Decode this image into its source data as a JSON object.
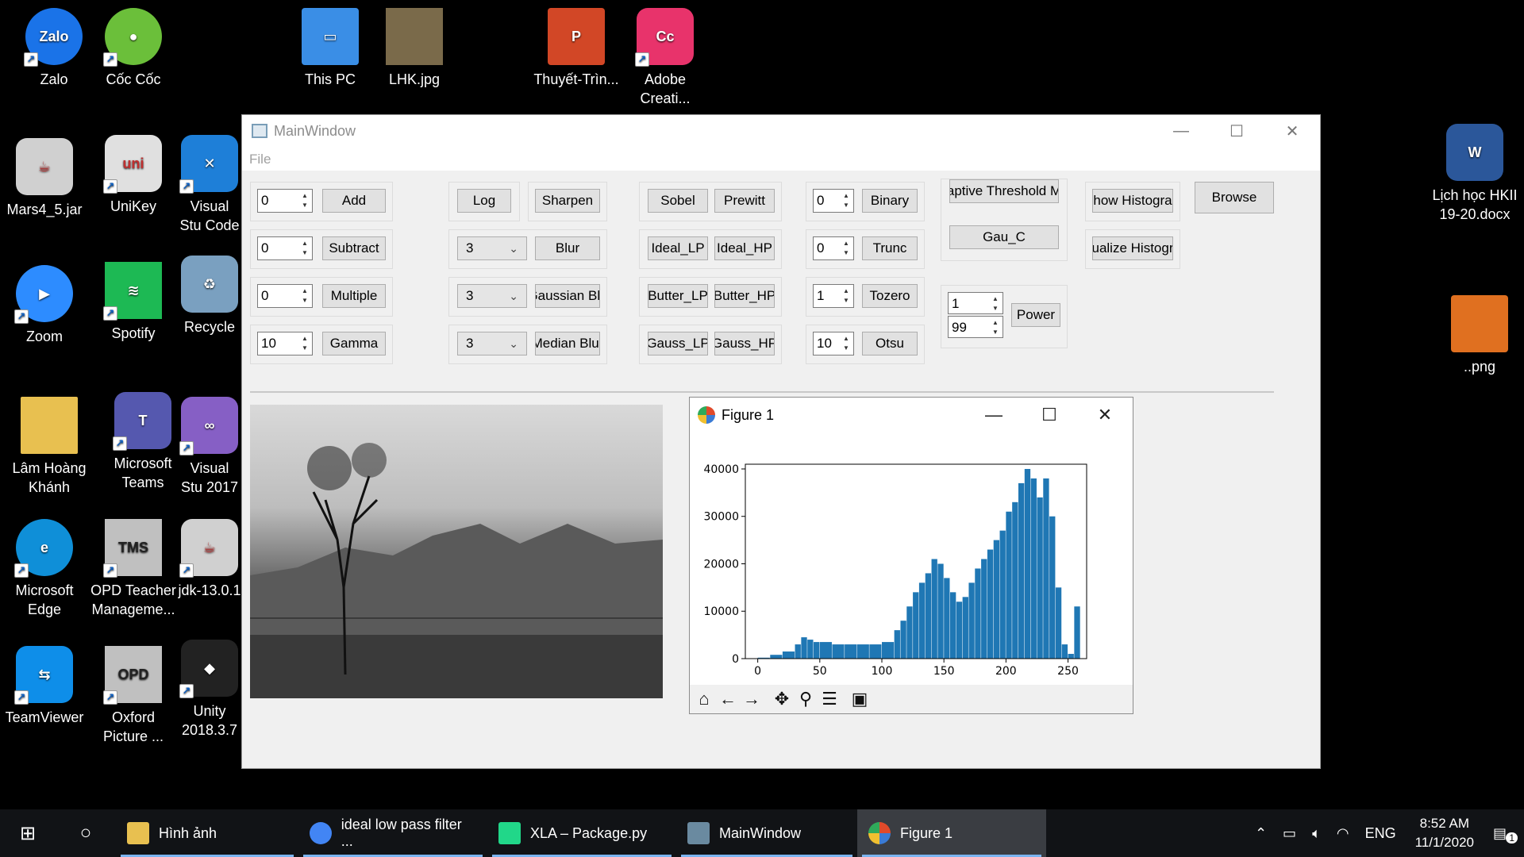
{
  "desktop": {
    "icons": [
      {
        "label": "Zalo",
        "color": "#1a73e8"
      },
      {
        "label": "Cốc Cốc",
        "color": "#6bbf3a"
      },
      {
        "label": "This PC",
        "color": "#3a8ee6"
      },
      {
        "label": "LHK.jpg",
        "color": "#7a6a4a"
      },
      {
        "label": "Thuyết-Trìn...",
        "color": "#d24726"
      },
      {
        "label": "Adobe Creati...",
        "color": "#e8336b"
      },
      {
        "label": "Mars4_5.jar",
        "color": "#d0d0d0"
      },
      {
        "label": "UniKey",
        "color": "#e0e0e0"
      },
      {
        "label": "Visual Stu Code",
        "color": "#1e7fd8"
      },
      {
        "label": "Lịch học HKII 19-20.docx",
        "color": "#2b579a"
      },
      {
        "label": "Zoom",
        "color": "#2d8cff"
      },
      {
        "label": "Spotify",
        "color": "#1db954"
      },
      {
        "label": "Recycle",
        "color": "#7aa0c0"
      },
      {
        "label": "..png",
        "color": "#e07020"
      },
      {
        "label": "Lâm Hoàng Khánh",
        "color": "#e8c050"
      },
      {
        "label": "Microsoft Teams",
        "color": "#5558af"
      },
      {
        "label": "Visual Stu 2017",
        "color": "#865fc5"
      },
      {
        "label": "Microsoft Edge",
        "color": "#0f8fd8"
      },
      {
        "label": "OPD Teacher Manageme...",
        "color": "#c0c0c0"
      },
      {
        "label": "jdk-13.0.1",
        "color": "#d0d0d0"
      },
      {
        "label": "TeamViewer",
        "color": "#0e8ee9"
      },
      {
        "label": "Oxford Picture ...",
        "color": "#c0c0c0"
      },
      {
        "label": "Unity 2018.3.7",
        "color": "#222222"
      }
    ]
  },
  "main_window": {
    "title": "MainWindow",
    "menu_file": "File",
    "controls": {
      "add_value": "0",
      "add_label": "Add",
      "subtract_value": "0",
      "subtract_label": "Subtract",
      "multiple_value": "0",
      "multiple_label": "Multiple",
      "gamma_value": "10",
      "gamma_label": "Gamma",
      "log_label": "Log",
      "sharpen_label": "Sharpen",
      "blur_kernel": "3",
      "blur_label": "Blur",
      "gaussian_kernel": "3",
      "gaussian_label": "Gaussian Blu",
      "median_kernel": "3",
      "median_label": "Median Blur",
      "sobel_label": "Sobel",
      "prewitt_label": "Prewitt",
      "ideal_lp_label": "Ideal_LP",
      "ideal_hp_label": "Ideal_HP",
      "butter_lp_label": "Butter_LP",
      "butter_hp_label": "Butter_HP",
      "gauss_lp_label": "Gauss_LP",
      "gauss_hp_label": "Gauss_HP",
      "binary_value": "0",
      "binary_label": "Binary",
      "trunc_value": "0",
      "trunc_label": "Trunc",
      "tozero_value": "1",
      "tozero_label": "Tozero",
      "otsu_value": "10",
      "otsu_label": "Otsu",
      "adaptive_label": "aptive Threshold M",
      "gau_c_label": "Gau_C",
      "power_value1": "1",
      "power_value2": "99",
      "power_label": "Power",
      "show_hist_label": "how Histogra",
      "equalize_hist_label": "ualize Histogr",
      "browse_label": "Browse"
    }
  },
  "figure_window": {
    "title": "Figure 1",
    "toolbar": [
      "home-icon",
      "back-icon",
      "forward-icon",
      "pan-icon",
      "zoom-icon",
      "configure-icon",
      "save-icon"
    ]
  },
  "chart_data": {
    "type": "bar",
    "title": "",
    "xlabel": "",
    "ylabel": "",
    "xlim": [
      -10,
      265
    ],
    "ylim": [
      0,
      41000
    ],
    "xticks": [
      0,
      50,
      100,
      150,
      200,
      250
    ],
    "yticks": [
      0,
      10000,
      20000,
      30000,
      40000
    ],
    "color": "#1f77b4",
    "grid": false,
    "series": [
      {
        "x": [
          0,
          10,
          20,
          30,
          35,
          40,
          45,
          50,
          60,
          70,
          80,
          90,
          100,
          110,
          115,
          120,
          125,
          130,
          135,
          140,
          145,
          150,
          155,
          160,
          165,
          170,
          175,
          180,
          185,
          190,
          195,
          200,
          205,
          210,
          215,
          220,
          225,
          230,
          235,
          240,
          245,
          250,
          255
        ],
        "values": [
          200,
          800,
          1500,
          3000,
          4500,
          4000,
          3500,
          3500,
          3000,
          3000,
          3000,
          3000,
          3500,
          6000,
          8000,
          11000,
          14000,
          16000,
          18000,
          21000,
          20000,
          17000,
          14000,
          12000,
          13000,
          16000,
          19000,
          21000,
          23000,
          25000,
          27000,
          31000,
          33000,
          37000,
          40000,
          38000,
          34000,
          38000,
          30000,
          15000,
          3000,
          1000,
          11000
        ]
      }
    ]
  },
  "taskbar": {
    "items": [
      {
        "label": "Hình ảnh"
      },
      {
        "label": "ideal low pass filter ..."
      },
      {
        "label": "XLA – Package.py"
      },
      {
        "label": "MainWindow"
      },
      {
        "label": "Figure 1"
      }
    ],
    "language": "ENG",
    "time": "8:52 AM",
    "date": "11/1/2020",
    "notifications": "1"
  }
}
